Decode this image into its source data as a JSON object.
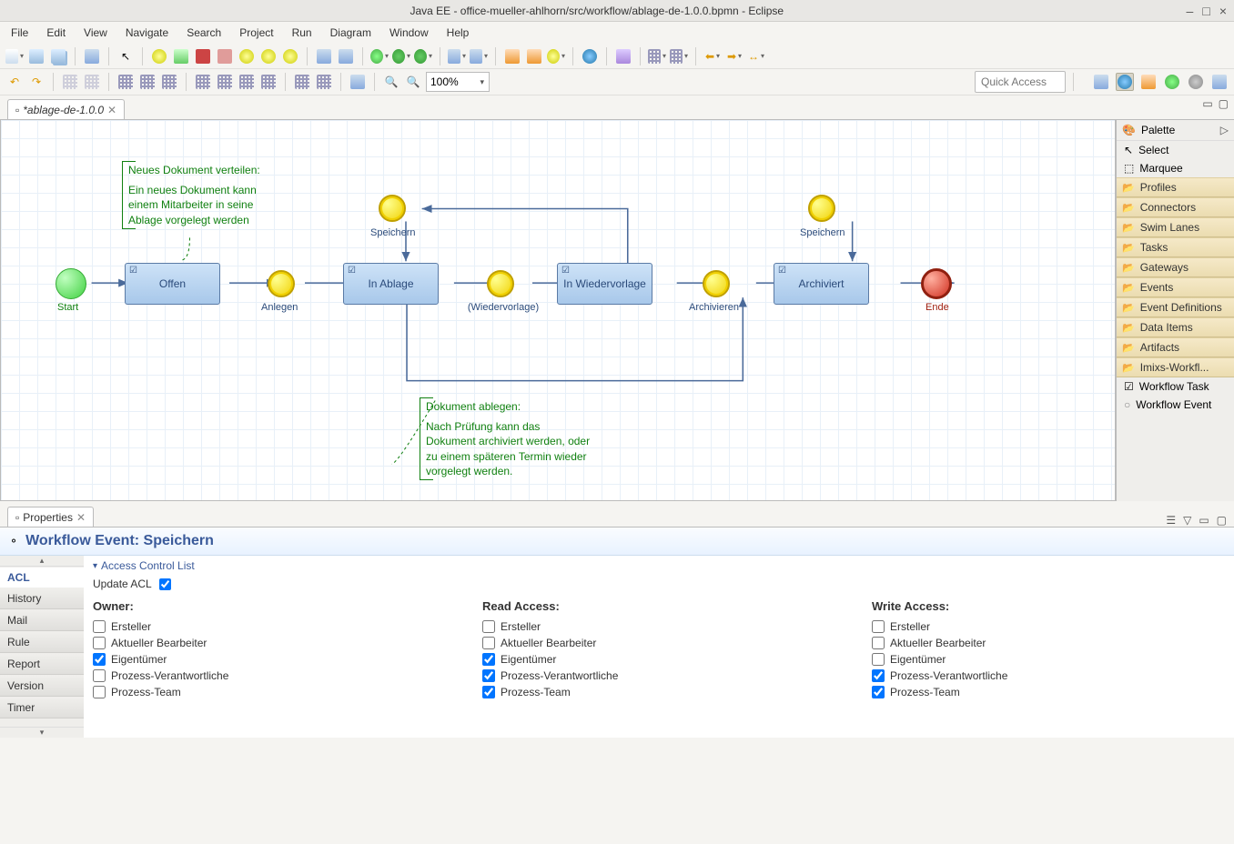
{
  "window": {
    "title": "Java EE - office-mueller-ahlhorn/src/workflow/ablage-de-1.0.0.bpmn - Eclipse"
  },
  "menu": [
    "File",
    "Edit",
    "View",
    "Navigate",
    "Search",
    "Project",
    "Run",
    "Diagram",
    "Window",
    "Help"
  ],
  "toolbar": {
    "zoom": "100%",
    "quick_access_placeholder": "Quick Access"
  },
  "editor_tab": {
    "label": "*ablage-de-1.0.0"
  },
  "palette": {
    "title": "Palette",
    "select": "Select",
    "marquee": "Marquee",
    "folders": [
      "Profiles",
      "Connectors",
      "Swim Lanes",
      "Tasks",
      "Gateways",
      "Events",
      "Event Definitions",
      "Data Items",
      "Artifacts",
      "Imixs-Workfl..."
    ],
    "wftask": "Workflow Task",
    "wfevent": "Workflow Event"
  },
  "diagram": {
    "start_label": "Start",
    "end_label": "Ende",
    "task_offen": "Offen",
    "task_inablage": "In Ablage",
    "task_wieder": "In Wiedervorlage",
    "task_archiv": "Archiviert",
    "ev_anlegen": "Anlegen",
    "ev_speichern1": "Speichern",
    "ev_wiedervorlage": "(Wiedervorlage)",
    "ev_archivieren": "Archivieren",
    "ev_speichern2": "Speichern",
    "ann1_title": "Neues Dokument verteilen:",
    "ann1_body": "Ein neues Dokument kann einem Mitarbeiter in seine Ablage vorgelegt werden",
    "ann2_title": "Dokument ablegen:",
    "ann2_body": "Nach Prüfung kann das Dokument archiviert werden, oder zu einem späteren Termin wieder vorgelegt werden."
  },
  "properties": {
    "tab_label": "Properties",
    "header": "Workflow Event: Speichern",
    "section": "Access Control List",
    "update_acl": "Update ACL",
    "sidebar": [
      "ACL",
      "History",
      "Mail",
      "Rule",
      "Report",
      "Version",
      "Timer"
    ],
    "owner_label": "Owner:",
    "read_label": "Read Access:",
    "write_label": "Write Access:",
    "roles": [
      "Ersteller",
      "Aktueller Bearbeiter",
      "Eigentümer",
      "Prozess-Verantwortliche",
      "Prozess-Team"
    ],
    "owner_checked": [
      false,
      false,
      true,
      false,
      false
    ],
    "read_checked": [
      false,
      false,
      true,
      true,
      true
    ],
    "write_checked": [
      false,
      false,
      false,
      true,
      true
    ]
  }
}
